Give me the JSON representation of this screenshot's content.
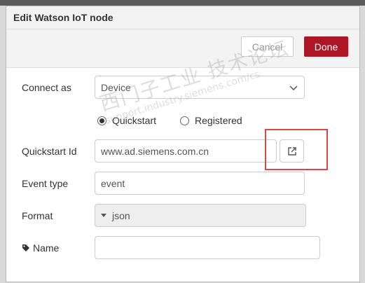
{
  "header": {
    "title": "Edit Watson IoT node"
  },
  "toolbar": {
    "cancel_label": "Cancel",
    "done_label": "Done"
  },
  "form": {
    "connect_as": {
      "label": "Connect as",
      "value": "Device"
    },
    "mode": {
      "options": [
        "Quickstart",
        "Registered"
      ],
      "selected": "Quickstart"
    },
    "quickstart_id": {
      "label": "Quickstart Id",
      "value": "www.ad.siemens.com.cn"
    },
    "event_type": {
      "label": "Event type",
      "value": "event"
    },
    "format": {
      "label": "Format",
      "value": "json"
    },
    "name": {
      "label": "Name",
      "value": ""
    }
  },
  "watermark": {
    "line1": "西门子工业 技术论坛",
    "line2": "support.industry.siemens.com/cs"
  },
  "colors": {
    "done_button": "#ad1625",
    "highlight_box": "#d64a4a"
  },
  "icons": {
    "external_link": "external-link-icon",
    "tag": "tag-icon",
    "dropdown": "chevron-down-icon"
  }
}
